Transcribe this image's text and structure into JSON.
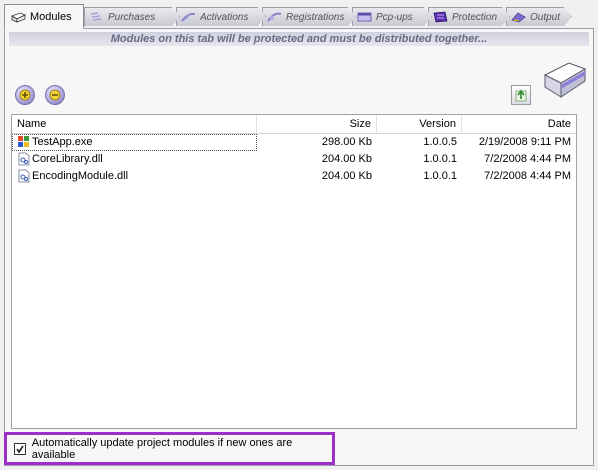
{
  "tabs": [
    {
      "label": "Modules",
      "icon": "modules-icon",
      "active": true
    },
    {
      "label": "Purchases",
      "icon": "purchases-icon",
      "active": false
    },
    {
      "label": "Activations",
      "icon": "activations-icon",
      "active": false
    },
    {
      "label": "Registrations",
      "icon": "registrations-icon",
      "active": false
    },
    {
      "label": "Pcp-ups",
      "icon": "popups-icon",
      "active": false
    },
    {
      "label": "Protection",
      "icon": "protection-icon",
      "active": false
    },
    {
      "label": "Output",
      "icon": "output-icon",
      "active": false
    }
  ],
  "banner": "Modules on this tab will be protected and must be distributed together...",
  "toolbar": {
    "add_icon": "add-icon",
    "remove_icon": "remove-icon",
    "upload_icon": "upload-icon"
  },
  "table": {
    "columns": {
      "name": "Name",
      "size": "Size",
      "version": "Version",
      "date": "Date"
    },
    "rows": [
      {
        "name": "TestApp.exe",
        "size": "298.00 Kb",
        "version": "1.0.0.5",
        "date": "2/19/2008 9:11 PM",
        "icon": "exe-icon"
      },
      {
        "name": "CoreLibrary.dll",
        "size": "204.00 Kb",
        "version": "1.0.0.1",
        "date": "7/2/2008 4:44 PM",
        "icon": "dll-icon"
      },
      {
        "name": "EncodingModule.dll",
        "size": "204.00 Kb",
        "version": "1.0.0.1",
        "date": "7/2/2008 4:44 PM",
        "icon": "dll-icon"
      }
    ]
  },
  "auto_update": {
    "label": "Automatically update project modules if new ones are available",
    "checked": true
  },
  "colors": {
    "highlight_border": "#9b30c8",
    "banner_text": "#6a6a86"
  }
}
